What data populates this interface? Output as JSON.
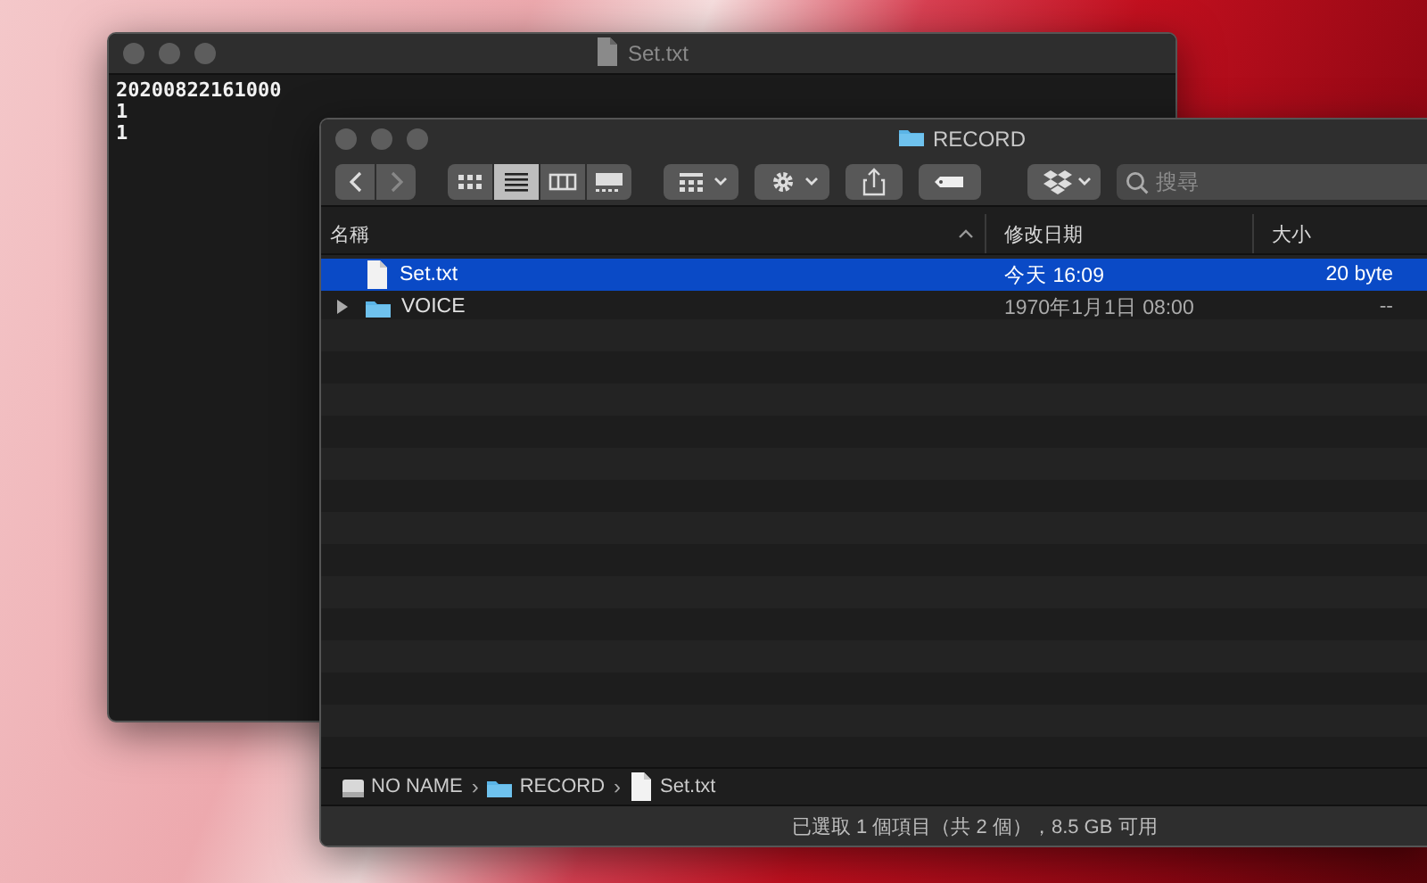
{
  "editor": {
    "title": "Set.txt",
    "lines": [
      "20200822161000",
      "1",
      "1"
    ]
  },
  "finder": {
    "title": "RECORD",
    "toolbar": {
      "view_modes": [
        {
          "kind": "icons",
          "selected": false
        },
        {
          "kind": "list",
          "selected": true
        },
        {
          "kind": "columns",
          "selected": false
        },
        {
          "kind": "gallery",
          "selected": false
        }
      ],
      "search": {
        "placeholder": "搜尋"
      }
    },
    "columns": [
      {
        "label": "名稱",
        "sorted": true
      },
      {
        "label": "修改日期",
        "sorted": false
      },
      {
        "label": "大小",
        "sorted": false
      }
    ],
    "rows": [
      {
        "kind": "file",
        "name": "Set.txt",
        "date": "今天 16:09",
        "size": "20 byte",
        "selected": true
      },
      {
        "kind": "folder",
        "name": "VOICE",
        "date": "1970年1月1日 08:00",
        "size": "--",
        "selected": false,
        "expanded": false
      }
    ],
    "path_bar": {
      "separator": "›",
      "items": [
        {
          "kind": "disk",
          "label": "NO NAME"
        },
        {
          "kind": "folder",
          "label": "RECORD"
        },
        {
          "kind": "file",
          "label": "Set.txt"
        }
      ]
    },
    "status": "已選取 1 個項目（共 2 個），8.5 GB 可用"
  }
}
